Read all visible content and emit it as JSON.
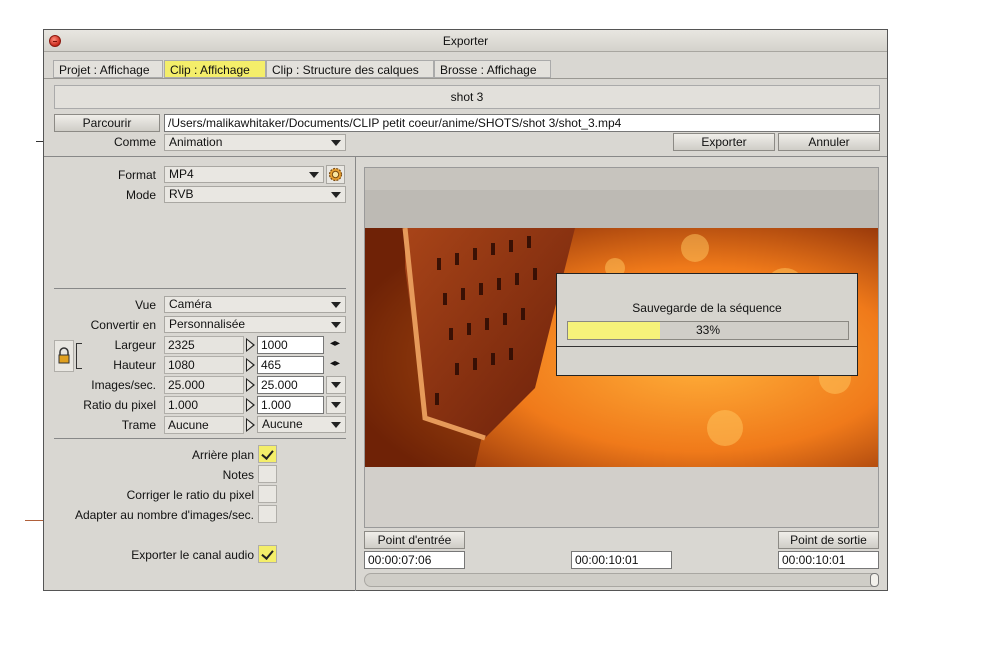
{
  "window": {
    "title": "Exporter"
  },
  "tabs": [
    {
      "label": "Projet : Affichage",
      "active": false
    },
    {
      "label": "Clip : Affichage",
      "active": true
    },
    {
      "label": "Clip : Structure des calques",
      "active": false
    },
    {
      "label": "Brosse : Affichage",
      "active": false
    }
  ],
  "header": {
    "shot_name": "shot 3"
  },
  "path_row": {
    "browse_label": "Parcourir",
    "path_value": "/Users/malikawhitaker/Documents/CLIP petit coeur/anime/SHOTS/shot 3/shot_3.mp4"
  },
  "comme_row": {
    "label": "Comme",
    "value": "Animation",
    "export_label": "Exporter",
    "cancel_label": "Annuler"
  },
  "settings": {
    "format": {
      "label": "Format",
      "value": "MP4",
      "icon": "gear-icon"
    },
    "mode": {
      "label": "Mode",
      "value": "RVB"
    },
    "vue": {
      "label": "Vue",
      "value": "Caméra"
    },
    "convertir": {
      "label": "Convertir en",
      "value": "Personnalisée"
    },
    "largeur": {
      "label": "Largeur",
      "source": "2325",
      "target": "1000"
    },
    "hauteur": {
      "label": "Hauteur",
      "source": "1080",
      "target": "465"
    },
    "fps": {
      "label": "Images/sec.",
      "source": "25.000",
      "target": "25.000"
    },
    "ratio": {
      "label": "Ratio du pixel",
      "source": "1.000",
      "target": "1.000"
    },
    "trame": {
      "label": "Trame",
      "source": "Aucune",
      "target": "Aucune"
    },
    "lock_icon": "lock-icon"
  },
  "checkboxes": [
    {
      "label": "Arrière plan",
      "checked": true
    },
    {
      "label": "Notes",
      "checked": false
    },
    {
      "label": "Corriger le ratio du pixel",
      "checked": false
    },
    {
      "label": "Adapter au nombre d'images/sec.",
      "checked": false
    },
    {
      "label": "Exporter le canal audio",
      "checked": true
    }
  ],
  "progress": {
    "title": "Sauvegarde de la séquence",
    "text": "33%",
    "fraction": 0.33
  },
  "timeline": {
    "in_label": "Point d'entrée",
    "out_label": "Point de sortie",
    "in_time": "00:00:07:06",
    "current_time": "00:00:10:01",
    "out_time": "00:00:10:01"
  },
  "colors": {
    "accent": "#f4ee6a",
    "window_bg": "#d9d7d2"
  }
}
